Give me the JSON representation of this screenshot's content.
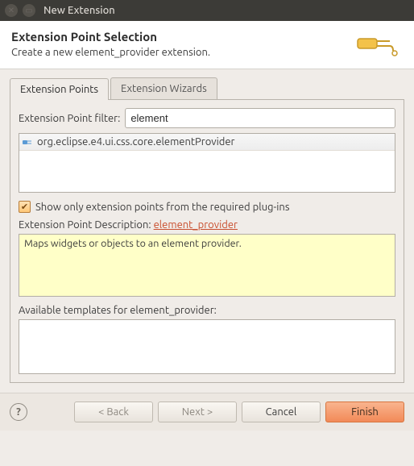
{
  "window": {
    "title": "New Extension"
  },
  "header": {
    "title": "Extension Point Selection",
    "subtitle": "Create a new element_provider extension."
  },
  "tabs": {
    "points": "Extension Points",
    "wizards": "Extension Wizards"
  },
  "filter": {
    "label": "Extension Point filter:",
    "value": "element"
  },
  "list": {
    "item0": "org.eclipse.e4.ui.css.core.elementProvider"
  },
  "checkbox": {
    "label": "Show only extension points from the required plug-ins"
  },
  "description": {
    "label_prefix": "Extension Point Description: ",
    "link": "element_provider",
    "text": "Maps widgets or objects to an element provider."
  },
  "templates": {
    "label": "Available templates for element_provider:"
  },
  "buttons": {
    "back": "< Back",
    "next": "Next >",
    "cancel": "Cancel",
    "finish": "Finish"
  }
}
